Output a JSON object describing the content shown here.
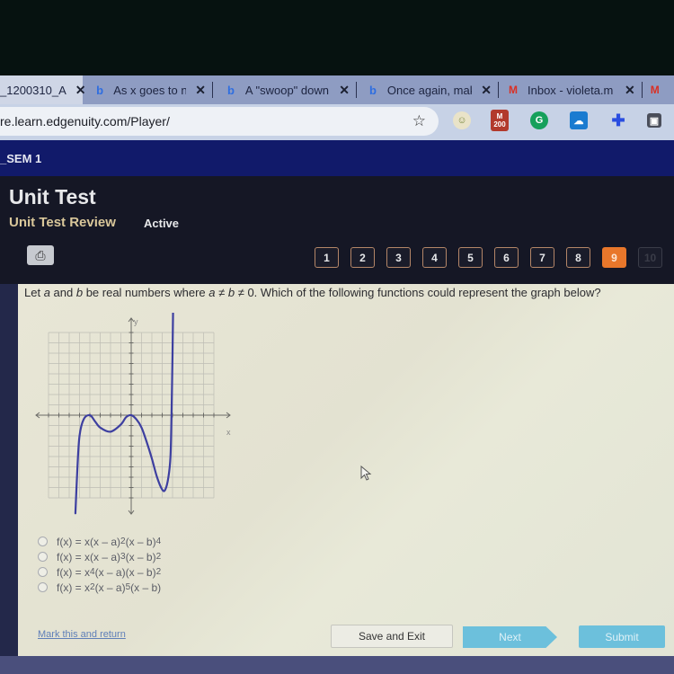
{
  "browser": {
    "tabs": [
      {
        "label": "_1200310_A",
        "icon": "edgenuity-icon",
        "active": true
      },
      {
        "label": "As x goes to neg",
        "icon": "bing-icon",
        "active": false
      },
      {
        "label": "A \"swoop\" down",
        "icon": "bing-icon",
        "active": false
      },
      {
        "label": "Once again, mak",
        "icon": "bing-icon",
        "active": false
      },
      {
        "label": "Inbox - violeta.m",
        "icon": "gmail-icon",
        "active": false
      }
    ],
    "close_glyph": "✕",
    "url": "re.learn.edgenuity.com/Player/",
    "extensions": [
      "profile-icon",
      "gmail-200-badge-icon",
      "grammarly-icon",
      "cloud-icon",
      "puzzle-extension-icon",
      "office-icon"
    ],
    "badge_text": "200"
  },
  "course": {
    "sem_label": "_SEM 1"
  },
  "header": {
    "title": "Unit Test",
    "subtitle": "Unit Test Review",
    "status": "Active"
  },
  "question_nav": {
    "items": [
      "1",
      "2",
      "3",
      "4",
      "5",
      "6",
      "7",
      "8",
      "9",
      "10"
    ],
    "current": 9,
    "colors": {
      "current": "#e8772b",
      "border": "#b48668"
    }
  },
  "question": {
    "prefix": "Let ",
    "a": "a",
    "and": " and ",
    "b": "b",
    "middle": " be real numbers where ",
    "cond_a": "a",
    "neq1": " ≠ ",
    "cond_b": "b",
    "neq2": " ≠ ",
    "suffix": "0. Which of the following functions could represent the graph below?"
  },
  "graph": {
    "x_label": "x",
    "y_label": "y",
    "x_range": [
      -8,
      8
    ],
    "y_range": [
      -8,
      8
    ],
    "curve_color": "#3d3fa0",
    "curve_points": [
      [
        -5.4,
        -9.5
      ],
      [
        -5.2,
        -5
      ],
      [
        -5,
        -2
      ],
      [
        -4.6,
        -0.4
      ],
      [
        -4,
        0
      ],
      [
        -3.5,
        -0.6
      ],
      [
        -3,
        -1.2
      ],
      [
        -2,
        -1.6
      ],
      [
        -1,
        -0.9
      ],
      [
        -0.5,
        -0.2
      ],
      [
        0,
        0
      ],
      [
        0.5,
        -0.4
      ],
      [
        1,
        -1.2
      ],
      [
        1.5,
        -2.6
      ],
      [
        2,
        -4.2
      ],
      [
        2.5,
        -6
      ],
      [
        3,
        -7.2
      ],
      [
        3.3,
        -7.2
      ],
      [
        3.6,
        -6
      ],
      [
        3.8,
        -4
      ],
      [
        3.9,
        0
      ],
      [
        4,
        6
      ],
      [
        4.05,
        10
      ]
    ]
  },
  "choices": [
    {
      "lead": "f(x) = x(x – a)",
      "e1": "2",
      "mid": "(x – b)",
      "e2": "4",
      "tail": ""
    },
    {
      "lead": "f(x) = x(x – a)",
      "e1": "3",
      "mid": "(x – b)",
      "e2": "2",
      "tail": ""
    },
    {
      "lead": "f(x) = x",
      "e1": "4",
      "mid": "(x – a)(x – b)",
      "e2": "2",
      "tail": ""
    },
    {
      "lead": "f(x) = x",
      "e1": "2",
      "mid": "(x – a)",
      "e2": "5",
      "tail": "(x – b)"
    }
  ],
  "footer": {
    "mark_link": "Mark this and return",
    "save_exit": "Save and Exit",
    "next": "Next",
    "submit": "Submit"
  }
}
